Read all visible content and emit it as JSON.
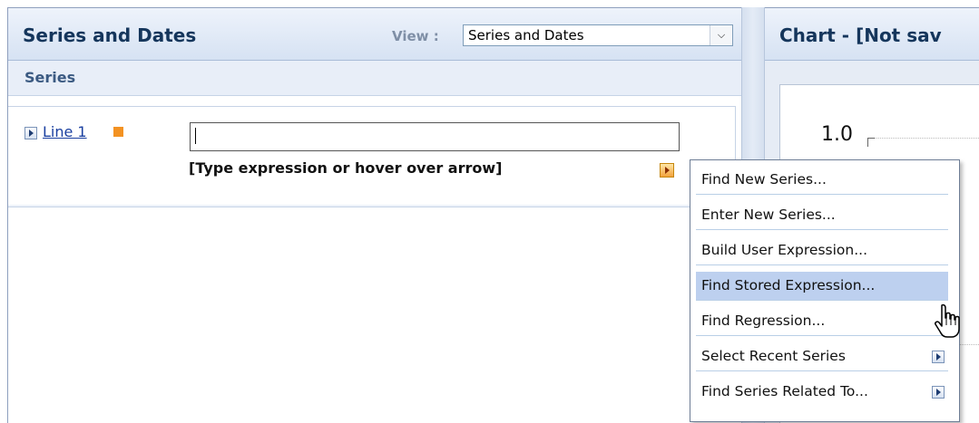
{
  "left_panel": {
    "title": "Series and Dates",
    "view_label": "View :",
    "view_select": {
      "value": "Series and Dates"
    }
  },
  "series_section": {
    "label": "Series",
    "row": {
      "link_label": "Line 1",
      "swatch_color": "#f39222",
      "expression_value": "",
      "hint": "[Type expression or hover over arrow]"
    }
  },
  "right_panel": {
    "title": "Chart - [Not sav",
    "y_tick": "1.0"
  },
  "context_menu": {
    "items": [
      {
        "label": "Find New Series...",
        "highlighted": false,
        "submenu": false
      },
      {
        "label": "Enter New Series...",
        "highlighted": false,
        "submenu": false
      },
      {
        "label": "Build User Expression...",
        "highlighted": false,
        "submenu": false
      },
      {
        "label": "Find Stored Expression...",
        "highlighted": true,
        "submenu": false
      },
      {
        "label": "Find Regression...",
        "highlighted": false,
        "submenu": false
      },
      {
        "label": "Select Recent Series",
        "highlighted": false,
        "submenu": true
      },
      {
        "label": "Find Series Related To...",
        "highlighted": false,
        "submenu": true
      }
    ]
  },
  "icons": {
    "expand": "expand-arrow-icon",
    "expression_menu": "expression-menu-arrow-icon",
    "submenu": "submenu-arrow-icon",
    "cursor": "hand-pointer-cursor-icon"
  }
}
